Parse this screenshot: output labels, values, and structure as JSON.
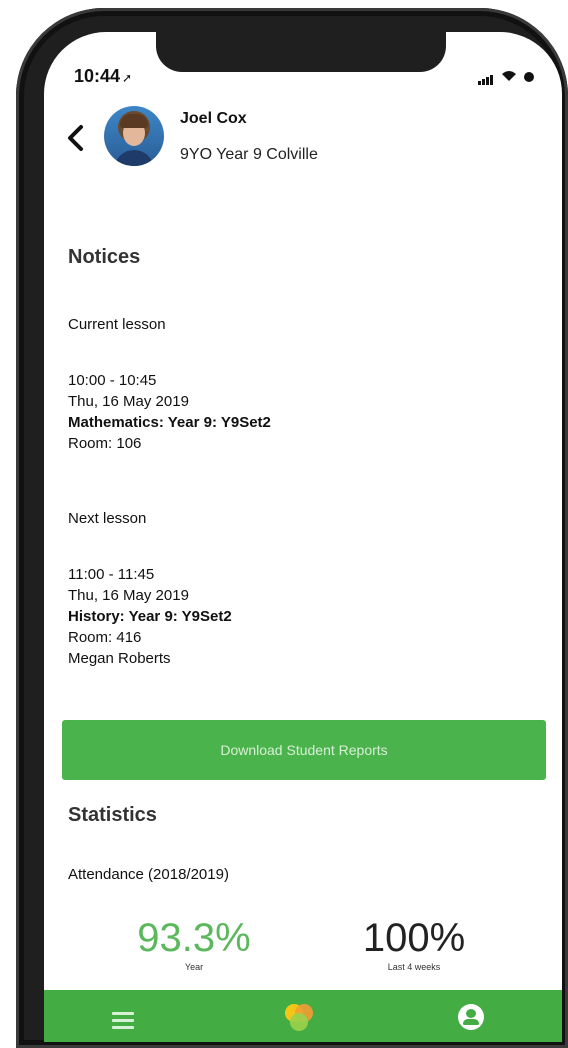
{
  "status_bar": {
    "time": "10:44",
    "arrow_icon": "location-arrow-icon",
    "signal_icon": "cellular-signal-icon",
    "wifi_icon": "wifi-icon",
    "battery_icon": "battery-icon"
  },
  "header": {
    "back_icon": "chevron-left-icon",
    "name": "Joel Cox",
    "meta": "9YO  Year 9  Colville"
  },
  "notices": {
    "title": "Notices",
    "current_label": "Current lesson",
    "current": {
      "time": "10:00 - 10:45",
      "date": "Thu, 16 May 2019",
      "subject": "Mathematics: Year 9: Y9Set2",
      "room": "Room: 106"
    },
    "next_label": "Next lesson",
    "next": {
      "time": "11:00 - 11:45",
      "date": "Thu, 16 May 2019",
      "subject": "History: Year 9: Y9Set2",
      "room": "Room: 416",
      "teacher": "Megan Roberts"
    }
  },
  "download_button": "Download Student Reports",
  "statistics": {
    "title": "Statistics",
    "attendance_label": "Attendance (2018/2019)",
    "year": {
      "value": "93.3%",
      "caption": "Year",
      "color": "#5cb85c"
    },
    "recent": {
      "value": "100%",
      "caption": "Last 4 weeks",
      "color": "#222222"
    }
  },
  "tabbar": {
    "color": "#43ad43",
    "menu_icon": "hamburger-menu-icon",
    "home_icon": "app-logo-icon",
    "profile_icon": "user-profile-icon"
  }
}
